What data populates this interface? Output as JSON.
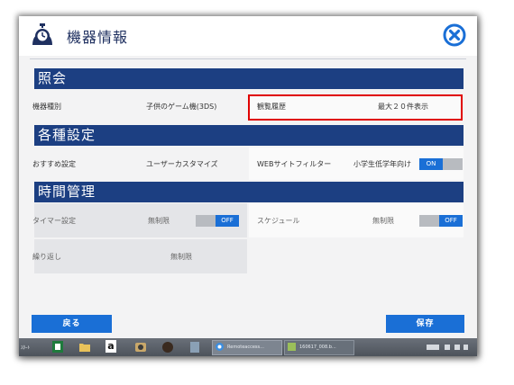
{
  "dialog": {
    "title": "機器情報",
    "close_icon": "close-circle-x-icon",
    "title_icon": "stopwatch-icon"
  },
  "inquiry": {
    "header": "照会",
    "device_type_label": "機器種別",
    "device_type_value": "子供のゲーム機(3DS)",
    "history_label": "観覧履歴",
    "history_value": "最大２０件表示"
  },
  "settings": {
    "header": "各種設定",
    "recommended_label": "おすすめ設定",
    "recommended_value": "ユーザーカスタマイズ",
    "web_filter_label": "WEBサイトフィルター",
    "web_filter_value": "小学生低学年向け",
    "web_filter_toggle": "ON"
  },
  "time": {
    "header": "時間管理",
    "timer_label": "タイマー設定",
    "timer_value": "無制限",
    "timer_toggle": "OFF",
    "schedule_label": "スケジュール",
    "schedule_value": "無制限",
    "schedule_toggle": "OFF",
    "repeat_label": "繰り返し",
    "repeat_value": "無制限"
  },
  "buttons": {
    "back": "戻る",
    "save": "保存"
  },
  "taskbar": {
    "left_text": "ｽﾀｰﾄ",
    "amazon_glyph": "a",
    "task1": "Remoteaccess...",
    "task2": "160617_008.b..."
  },
  "colors": {
    "header_blue": "#1c3f82",
    "button_blue": "#1a6fd6",
    "highlight_red": "#e00000"
  }
}
